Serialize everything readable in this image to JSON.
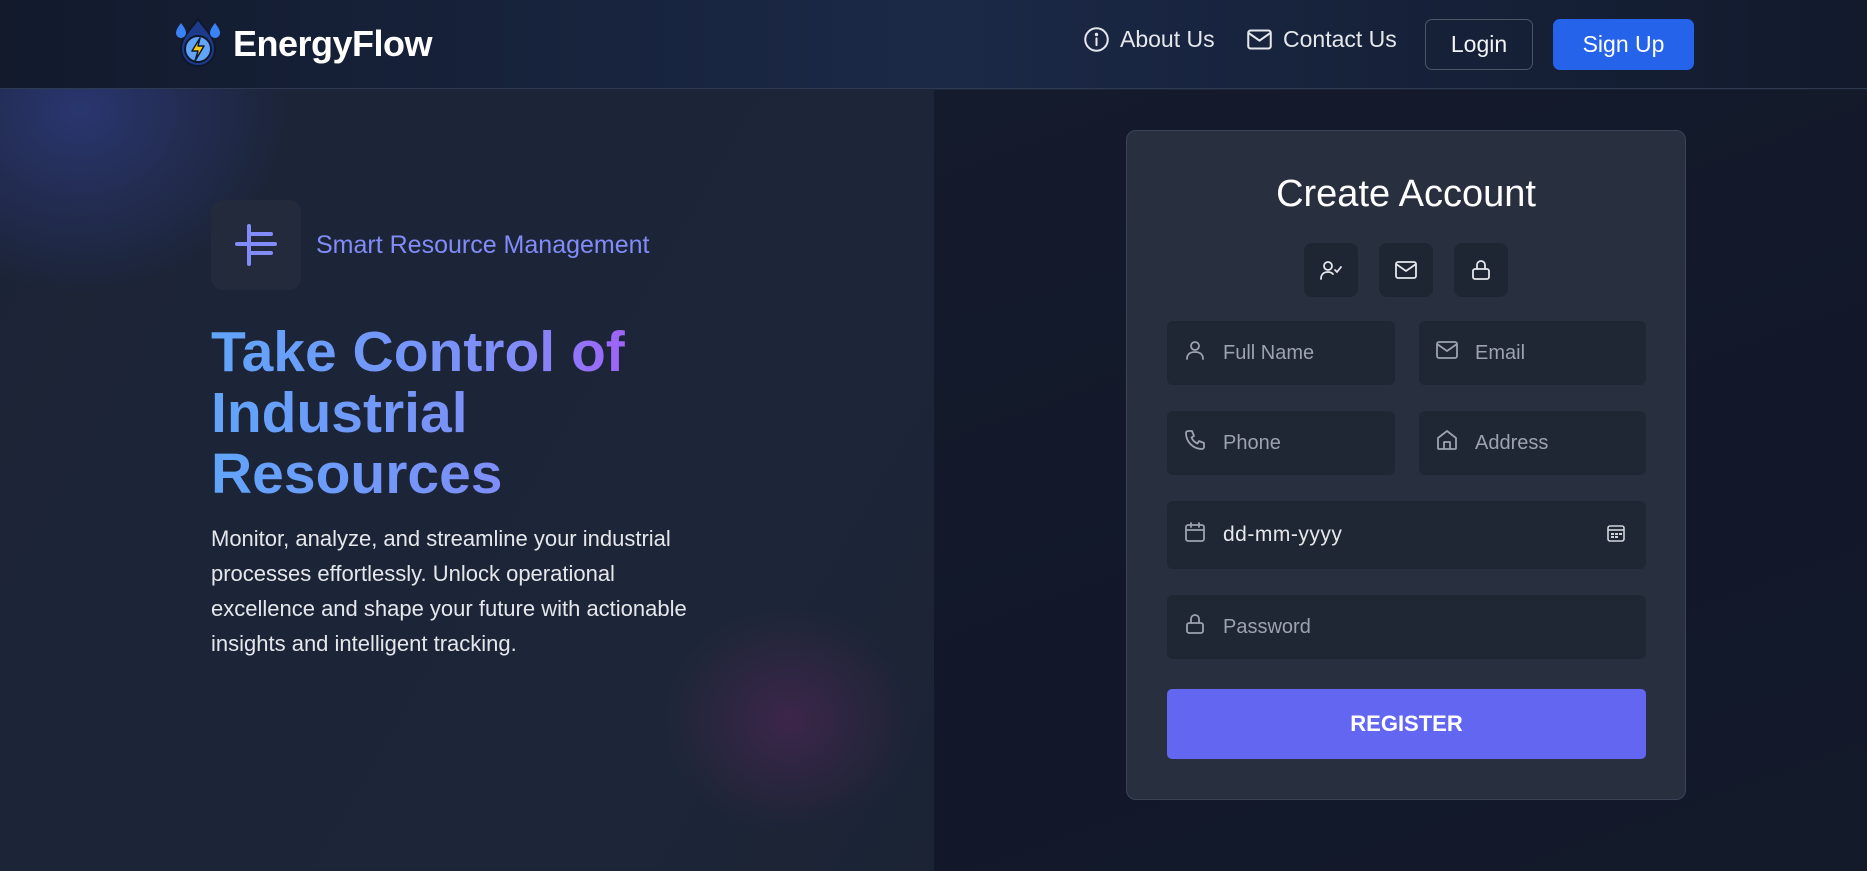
{
  "nav": {
    "brand": "EnergyFlow",
    "about": "About Us",
    "contact": "Contact Us",
    "login": "Login",
    "signup": "Sign Up"
  },
  "hero": {
    "badge": "Smart Resource Management",
    "title_line1": "Take Control of",
    "title_line2": "Industrial",
    "title_line3": "Resources",
    "description": "Monitor, analyze, and streamline your industrial processes effortlessly. Unlock operational excellence and shape your future with actionable insights and intelligent tracking."
  },
  "form": {
    "title": "Create Account",
    "full_name_placeholder": "Full Name",
    "email_placeholder": "Email",
    "phone_placeholder": "Phone",
    "address_placeholder": "Address",
    "date_value": "dd-mm-yyyy",
    "password_placeholder": "Password",
    "register": "REGISTER"
  },
  "colors": {
    "accent": "#6366f1",
    "signup": "#2563eb",
    "badge_text": "#818cf8"
  },
  "icons": {
    "logo": "energy-drop-icon",
    "about": "info-icon",
    "contact": "mail-icon",
    "steps": [
      "user-check-icon",
      "mail-icon",
      "lock-icon"
    ]
  }
}
